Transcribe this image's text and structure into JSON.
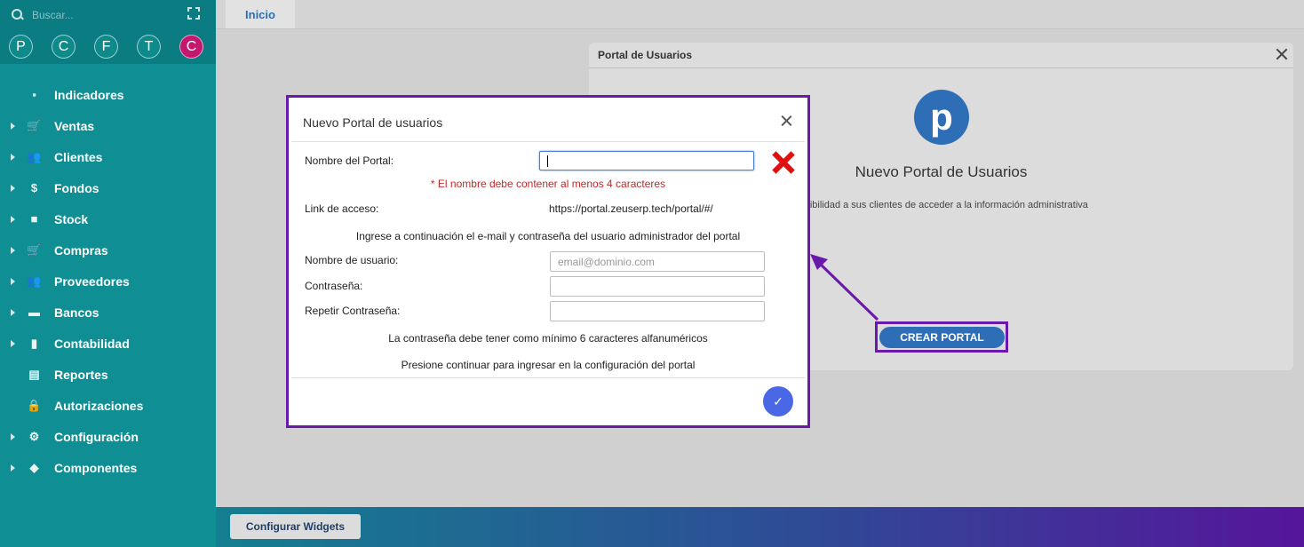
{
  "sidebar": {
    "search_placeholder": "Buscar...",
    "circles": [
      {
        "letter": "P",
        "color": "#0e8a8a"
      },
      {
        "letter": "C",
        "color": "#0e8a8a"
      },
      {
        "letter": "F",
        "color": "#0e8a8a"
      },
      {
        "letter": "T",
        "color": "#0e8a8a"
      },
      {
        "letter": "C",
        "color": "#c4186e"
      }
    ],
    "items": [
      {
        "label": "Indicadores",
        "icon": "dashboard-icon",
        "expandable": false
      },
      {
        "label": "Ventas",
        "icon": "cart-icon",
        "expandable": true
      },
      {
        "label": "Clientes",
        "icon": "people-icon",
        "expandable": true
      },
      {
        "label": "Fondos",
        "icon": "dollar-icon",
        "expandable": true
      },
      {
        "label": "Stock",
        "icon": "stack-icon",
        "expandable": true
      },
      {
        "label": "Compras",
        "icon": "cart-add-icon",
        "expandable": true
      },
      {
        "label": "Proveedores",
        "icon": "people-icon",
        "expandable": true
      },
      {
        "label": "Bancos",
        "icon": "briefcase-icon",
        "expandable": true
      },
      {
        "label": "Contabilidad",
        "icon": "book-icon",
        "expandable": true
      },
      {
        "label": "Reportes",
        "icon": "report-icon",
        "expandable": false
      },
      {
        "label": "Autorizaciones",
        "icon": "lock-icon",
        "expandable": false
      },
      {
        "label": "Configuración",
        "icon": "gears-icon",
        "expandable": true
      },
      {
        "label": "Componentes",
        "icon": "tag-icon",
        "expandable": true
      }
    ]
  },
  "topbar": {
    "tab_label": "Inicio"
  },
  "portal_panel": {
    "title": "Portal de Usuarios",
    "logo_letter": "p",
    "heading": "Nuevo Portal de Usuarios",
    "description": "posibilidad a sus clientes de acceder a la información administrativa",
    "create_button": "CREAR PORTAL"
  },
  "bottombar": {
    "config_button": "Configurar Widgets"
  },
  "modal": {
    "title": "Nuevo Portal de usuarios",
    "portal_name_label": "Nombre del Portal:",
    "portal_name_value": "",
    "error_text": "* El nombre debe contener al menos 4 caracteres",
    "access_link_label": "Link de acceso:",
    "access_link_value": "https://portal.zeuserp.tech/portal/#/",
    "admin_instruction": "Ingrese a continuación el e-mail y contraseña del usuario administrador del portal",
    "username_label": "Nombre de usuario:",
    "username_placeholder": "email@dominio.com",
    "password_label": "Contraseña:",
    "repeat_password_label": "Repetir Contraseña:",
    "password_rule": "La contraseña debe tener como mínimo 6 caracteres alfanuméricos",
    "continue_text": "Presione continuar para ingresar en la configuración del portal"
  },
  "colors": {
    "sidebar": "#0f8f94",
    "accent_blue": "#2d6eb6",
    "highlight_purple": "#6a1aaa",
    "error_red": "#c62828",
    "confirm_button": "#4a67e6"
  }
}
